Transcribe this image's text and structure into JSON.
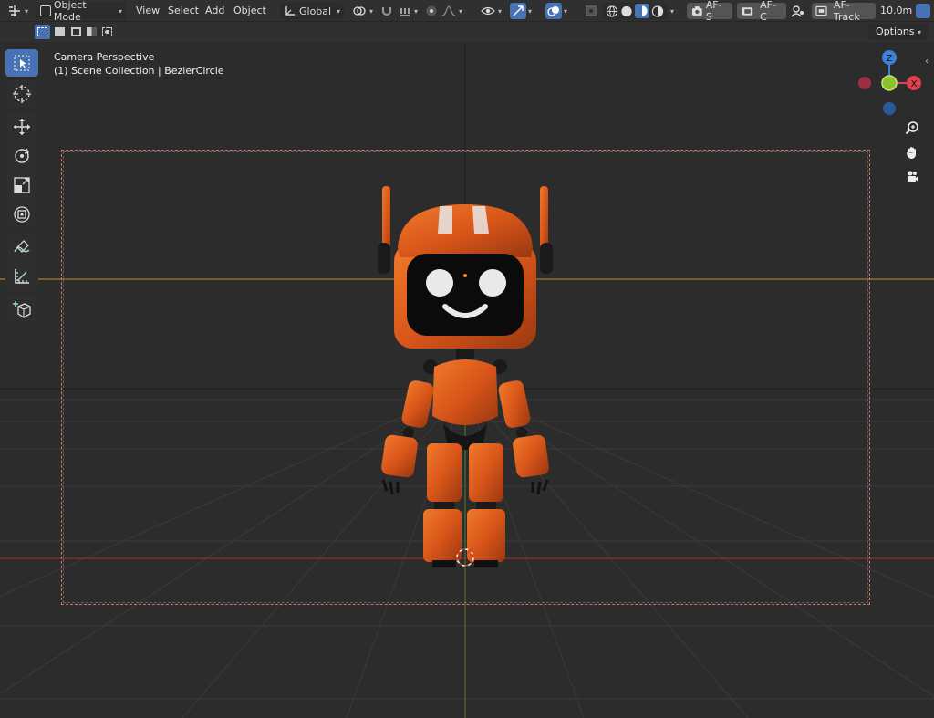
{
  "header": {
    "editor_type_icon": "viewport-icon",
    "mode_label": "Object Mode",
    "menus": [
      "View",
      "Select",
      "Add",
      "Object"
    ],
    "orientation_label": "Global",
    "camera_buttons": {
      "af_s": "AF-S",
      "af_c": "AF-C",
      "af_track": "AF-Track"
    },
    "focal_value": "10.0m"
  },
  "subheader": {
    "options_label": "Options"
  },
  "viewport": {
    "title_line1": "Camera Perspective",
    "title_line2": "(1) Scene Collection | BezierCircle"
  },
  "gizmo": {
    "z_label": "Z",
    "y_label": "Y",
    "x_label": "X"
  },
  "toolbar": {
    "tools": [
      "select-box",
      "cursor",
      "move",
      "rotate",
      "scale",
      "transform",
      "annotate",
      "measure",
      "add-cube"
    ]
  },
  "colors": {
    "accent": "#4772b3",
    "x_axis": "#e0414f",
    "y_axis": "#8ac12d",
    "z_axis": "#3f80d8",
    "robot_orange": "#e0601a",
    "camera_frame": "#e07060",
    "horizon": "#c88a2a"
  }
}
